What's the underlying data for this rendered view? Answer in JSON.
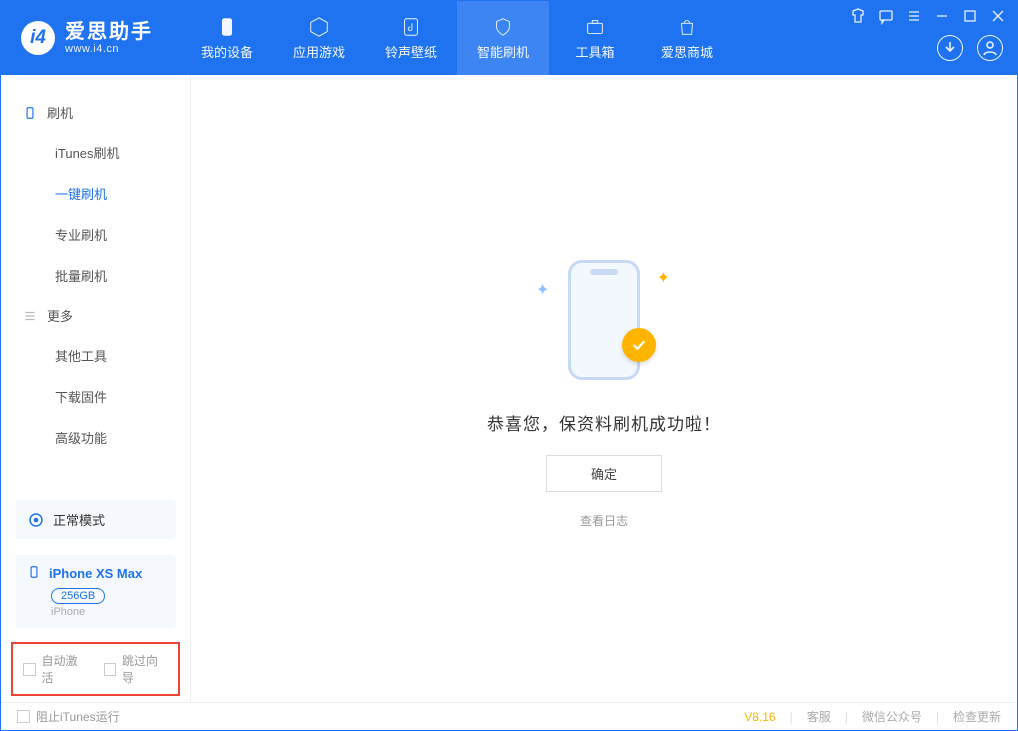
{
  "logo": {
    "title": "爱思助手",
    "sub": "www.i4.cn"
  },
  "nav": {
    "device": "我的设备",
    "apps": "应用游戏",
    "ringtone": "铃声壁纸",
    "flash": "智能刷机",
    "toolbox": "工具箱",
    "store": "爱思商城"
  },
  "sidebar": {
    "section_flash": "刷机",
    "items_flash": {
      "itunes": "iTunes刷机",
      "onekey": "一键刷机",
      "pro": "专业刷机",
      "batch": "批量刷机"
    },
    "section_more": "更多",
    "items_more": {
      "other": "其他工具",
      "firmware": "下载固件",
      "advanced": "高级功能"
    }
  },
  "device_panel": {
    "mode": "正常模式",
    "name": "iPhone XS Max",
    "storage": "256GB",
    "type": "iPhone"
  },
  "options": {
    "auto_activate": "自动激活",
    "skip_guide": "跳过向导"
  },
  "main": {
    "success": "恭喜您，保资料刷机成功啦！",
    "ok": "确定",
    "log": "查看日志"
  },
  "statusbar": {
    "block_itunes": "阻止iTunes运行",
    "version": "V8.16",
    "cs": "客服",
    "wechat": "微信公众号",
    "update": "检查更新"
  }
}
